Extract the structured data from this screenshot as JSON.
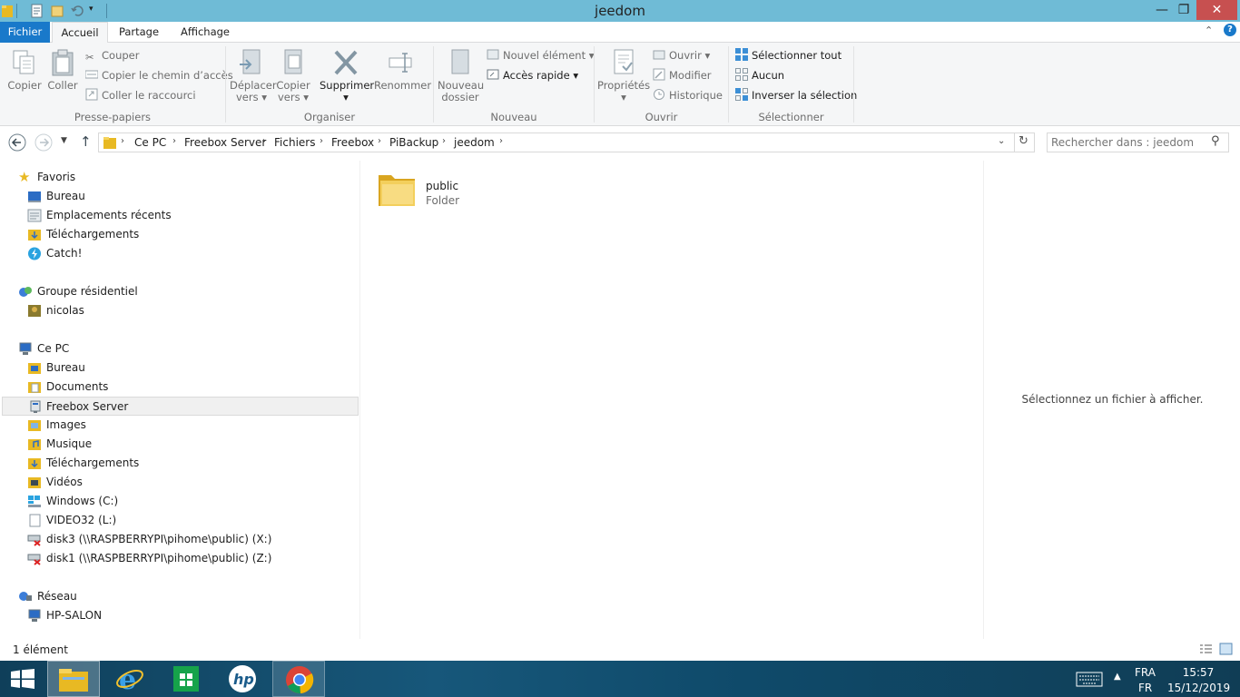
{
  "window": {
    "title": "jeedom",
    "min": "—",
    "max": "❐",
    "close": "✕"
  },
  "ribbon_tabs": {
    "fichier": "Fichier",
    "accueil": "Accueil",
    "partage": "Partage",
    "affichage": "Affichage"
  },
  "ribbon": {
    "presse": {
      "copier": "Copier",
      "coller": "Coller",
      "couper": "Couper",
      "copier_chemin": "Copier le chemin d’accès",
      "coller_raccourci": "Coller le raccourci",
      "label": "Presse-papiers"
    },
    "organiser": {
      "deplacer_1": "Déplacer",
      "deplacer_2": "vers",
      "copier_1": "Copier",
      "copier_2": "vers",
      "supprimer": "Supprimer",
      "renommer": "Renommer",
      "label": "Organiser"
    },
    "nouveau": {
      "dossier_1": "Nouveau",
      "dossier_2": "dossier",
      "element": "Nouvel élément",
      "acces": "Accès rapide",
      "label": "Nouveau"
    },
    "ouvrir": {
      "proprietes": "Propriétés",
      "ouvrir": "Ouvrir",
      "modifier": "Modifier",
      "historique": "Historique",
      "label": "Ouvrir"
    },
    "selectionner": {
      "tout": "Sélectionner tout",
      "aucun": "Aucun",
      "inverser": "Inverser la sélection",
      "label": "Sélectionner"
    }
  },
  "breadcrumb": [
    "Ce PC",
    "Freebox Server",
    "Fichiers",
    "Freebox",
    "PiBackup",
    "jeedom"
  ],
  "search": {
    "placeholder": "Rechercher dans : jeedom"
  },
  "nav": {
    "favoris": "Favoris",
    "bureau": "Bureau",
    "recents": "Emplacements récents",
    "telechargements": "Téléchargements",
    "catch": "Catch!",
    "groupe": "Groupe résidentiel",
    "nicolas": "nicolas",
    "cepc": "Ce PC",
    "bureau2": "Bureau",
    "documents": "Documents",
    "freebox": "Freebox Server",
    "images": "Images",
    "musique": "Musique",
    "telechargements2": "Téléchargements",
    "videos": "Vidéos",
    "windows": "Windows (C:)",
    "video32": "VIDEO32 (L:)",
    "disk3": "disk3 (\\\\RASPBERRYPI\\pihome\\public) (X:)",
    "disk1": "disk1 (\\\\RASPBERRYPI\\pihome\\public) (Z:)",
    "reseau": "Réseau",
    "hpsalon": "HP-SALON"
  },
  "items": [
    {
      "name": "public",
      "type": "Folder"
    }
  ],
  "preview_text": "Sélectionnez un fichier à afficher.",
  "status": "1 élément",
  "tray": {
    "lang1": "FRA",
    "lang2": "FR",
    "time": "15:57",
    "date": "15/12/2019"
  },
  "colors": {
    "title": "#6fbbd6",
    "fichier_tab": "#1979ca",
    "close": "#c75050",
    "taskbar": "#17577a"
  }
}
